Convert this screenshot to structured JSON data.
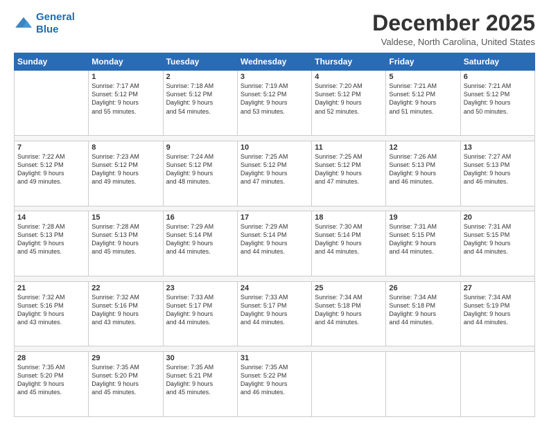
{
  "logo": {
    "line1": "General",
    "line2": "Blue"
  },
  "header": {
    "month": "December 2025",
    "location": "Valdese, North Carolina, United States"
  },
  "days": [
    "Sunday",
    "Monday",
    "Tuesday",
    "Wednesday",
    "Thursday",
    "Friday",
    "Saturday"
  ],
  "weeks": [
    [
      {
        "day": "",
        "info": ""
      },
      {
        "day": "1",
        "info": "Sunrise: 7:17 AM\nSunset: 5:12 PM\nDaylight: 9 hours\nand 55 minutes."
      },
      {
        "day": "2",
        "info": "Sunrise: 7:18 AM\nSunset: 5:12 PM\nDaylight: 9 hours\nand 54 minutes."
      },
      {
        "day": "3",
        "info": "Sunrise: 7:19 AM\nSunset: 5:12 PM\nDaylight: 9 hours\nand 53 minutes."
      },
      {
        "day": "4",
        "info": "Sunrise: 7:20 AM\nSunset: 5:12 PM\nDaylight: 9 hours\nand 52 minutes."
      },
      {
        "day": "5",
        "info": "Sunrise: 7:21 AM\nSunset: 5:12 PM\nDaylight: 9 hours\nand 51 minutes."
      },
      {
        "day": "6",
        "info": "Sunrise: 7:21 AM\nSunset: 5:12 PM\nDaylight: 9 hours\nand 50 minutes."
      }
    ],
    [
      {
        "day": "7",
        "info": "Sunrise: 7:22 AM\nSunset: 5:12 PM\nDaylight: 9 hours\nand 49 minutes."
      },
      {
        "day": "8",
        "info": "Sunrise: 7:23 AM\nSunset: 5:12 PM\nDaylight: 9 hours\nand 49 minutes."
      },
      {
        "day": "9",
        "info": "Sunrise: 7:24 AM\nSunset: 5:12 PM\nDaylight: 9 hours\nand 48 minutes."
      },
      {
        "day": "10",
        "info": "Sunrise: 7:25 AM\nSunset: 5:12 PM\nDaylight: 9 hours\nand 47 minutes."
      },
      {
        "day": "11",
        "info": "Sunrise: 7:25 AM\nSunset: 5:12 PM\nDaylight: 9 hours\nand 47 minutes."
      },
      {
        "day": "12",
        "info": "Sunrise: 7:26 AM\nSunset: 5:13 PM\nDaylight: 9 hours\nand 46 minutes."
      },
      {
        "day": "13",
        "info": "Sunrise: 7:27 AM\nSunset: 5:13 PM\nDaylight: 9 hours\nand 46 minutes."
      }
    ],
    [
      {
        "day": "14",
        "info": "Sunrise: 7:28 AM\nSunset: 5:13 PM\nDaylight: 9 hours\nand 45 minutes."
      },
      {
        "day": "15",
        "info": "Sunrise: 7:28 AM\nSunset: 5:13 PM\nDaylight: 9 hours\nand 45 minutes."
      },
      {
        "day": "16",
        "info": "Sunrise: 7:29 AM\nSunset: 5:14 PM\nDaylight: 9 hours\nand 44 minutes."
      },
      {
        "day": "17",
        "info": "Sunrise: 7:29 AM\nSunset: 5:14 PM\nDaylight: 9 hours\nand 44 minutes."
      },
      {
        "day": "18",
        "info": "Sunrise: 7:30 AM\nSunset: 5:14 PM\nDaylight: 9 hours\nand 44 minutes."
      },
      {
        "day": "19",
        "info": "Sunrise: 7:31 AM\nSunset: 5:15 PM\nDaylight: 9 hours\nand 44 minutes."
      },
      {
        "day": "20",
        "info": "Sunrise: 7:31 AM\nSunset: 5:15 PM\nDaylight: 9 hours\nand 44 minutes."
      }
    ],
    [
      {
        "day": "21",
        "info": "Sunrise: 7:32 AM\nSunset: 5:16 PM\nDaylight: 9 hours\nand 43 minutes."
      },
      {
        "day": "22",
        "info": "Sunrise: 7:32 AM\nSunset: 5:16 PM\nDaylight: 9 hours\nand 43 minutes."
      },
      {
        "day": "23",
        "info": "Sunrise: 7:33 AM\nSunset: 5:17 PM\nDaylight: 9 hours\nand 44 minutes."
      },
      {
        "day": "24",
        "info": "Sunrise: 7:33 AM\nSunset: 5:17 PM\nDaylight: 9 hours\nand 44 minutes."
      },
      {
        "day": "25",
        "info": "Sunrise: 7:34 AM\nSunset: 5:18 PM\nDaylight: 9 hours\nand 44 minutes."
      },
      {
        "day": "26",
        "info": "Sunrise: 7:34 AM\nSunset: 5:18 PM\nDaylight: 9 hours\nand 44 minutes."
      },
      {
        "day": "27",
        "info": "Sunrise: 7:34 AM\nSunset: 5:19 PM\nDaylight: 9 hours\nand 44 minutes."
      }
    ],
    [
      {
        "day": "28",
        "info": "Sunrise: 7:35 AM\nSunset: 5:20 PM\nDaylight: 9 hours\nand 45 minutes."
      },
      {
        "day": "29",
        "info": "Sunrise: 7:35 AM\nSunset: 5:20 PM\nDaylight: 9 hours\nand 45 minutes."
      },
      {
        "day": "30",
        "info": "Sunrise: 7:35 AM\nSunset: 5:21 PM\nDaylight: 9 hours\nand 45 minutes."
      },
      {
        "day": "31",
        "info": "Sunrise: 7:35 AM\nSunset: 5:22 PM\nDaylight: 9 hours\nand 46 minutes."
      },
      {
        "day": "",
        "info": ""
      },
      {
        "day": "",
        "info": ""
      },
      {
        "day": "",
        "info": ""
      }
    ]
  ]
}
